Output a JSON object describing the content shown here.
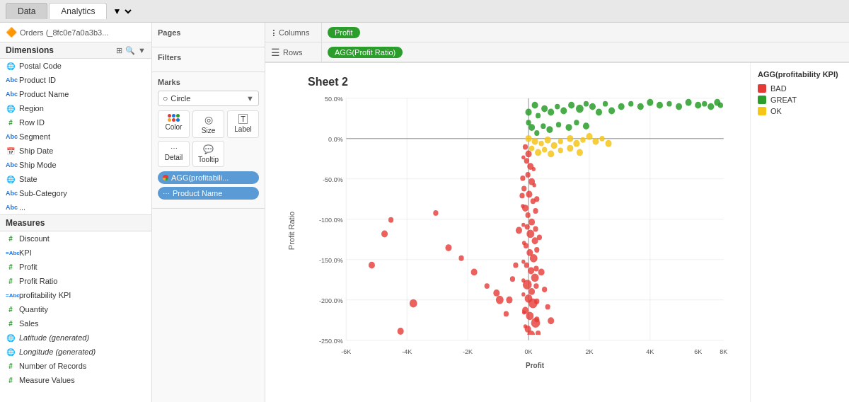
{
  "tabs": {
    "data_label": "Data",
    "analytics_label": "Analytics"
  },
  "datasource": {
    "icon": "🔶",
    "name": "Orders (_8fc0e7a0a3b3..."
  },
  "dimensions": {
    "header": "Dimensions",
    "items": [
      {
        "icon": "🌐",
        "type": "globe",
        "name": "Postal Code"
      },
      {
        "icon": "Abc",
        "type": "blue",
        "name": "Product ID"
      },
      {
        "icon": "Abc",
        "type": "blue",
        "name": "Product Name"
      },
      {
        "icon": "🌐",
        "type": "globe",
        "name": "Region"
      },
      {
        "icon": "#",
        "type": "green",
        "name": "Row ID"
      },
      {
        "icon": "Abc",
        "type": "blue",
        "name": "Segment"
      },
      {
        "icon": "📅",
        "type": "blue",
        "name": "Ship Date"
      },
      {
        "icon": "Abc",
        "type": "blue",
        "name": "Ship Mode"
      },
      {
        "icon": "🌐",
        "type": "globe",
        "name": "State"
      },
      {
        "icon": "Abc",
        "type": "blue",
        "name": "Sub-Category"
      },
      {
        "icon": "Abc",
        "type": "blue",
        "name": "..."
      }
    ]
  },
  "measures": {
    "header": "Measures",
    "items": [
      {
        "icon": "#",
        "type": "green",
        "name": "Discount"
      },
      {
        "icon": "=Abc",
        "type": "blue",
        "name": "KPI"
      },
      {
        "icon": "#",
        "type": "green",
        "name": "Profit"
      },
      {
        "icon": "#",
        "type": "green",
        "name": "Profit Ratio"
      },
      {
        "icon": "=Abc",
        "type": "blue",
        "name": "profitability KPI"
      },
      {
        "icon": "#",
        "type": "green",
        "name": "Quantity"
      },
      {
        "icon": "#",
        "type": "green",
        "name": "Sales"
      },
      {
        "icon": "🌐",
        "type": "globe",
        "name": "Latitude (generated)"
      },
      {
        "icon": "🌐",
        "type": "globe",
        "name": "Longitude (generated)"
      },
      {
        "icon": "#",
        "type": "green",
        "name": "Number of Records"
      },
      {
        "icon": "#",
        "type": "green",
        "name": "Measure Values"
      }
    ]
  },
  "pages": {
    "label": "Pages"
  },
  "filters": {
    "label": "Filters"
  },
  "marks": {
    "label": "Marks",
    "type": "Circle",
    "color_label": "Color",
    "size_label": "Size",
    "label_label": "Label",
    "detail_label": "Detail",
    "tooltip_label": "Tooltip",
    "pill1": "AGG(profitabili...",
    "pill2": "Product Name"
  },
  "shelves": {
    "columns_label": "Columns",
    "rows_label": "Rows",
    "columns_pill": "Profit",
    "rows_pill": "AGG(Profit Ratio)"
  },
  "chart": {
    "title": "Sheet 2",
    "x_label": "Profit",
    "y_label": "Profit Ratio",
    "x_ticks": [
      "-6K",
      "-4K",
      "-2K",
      "0K",
      "2K",
      "4K",
      "6K",
      "8K"
    ],
    "y_ticks": [
      "50.0%",
      "0.0%",
      "-50.0%",
      "-100.0%",
      "-150.0%",
      "-200.0%",
      "-250.0%"
    ]
  },
  "legend": {
    "title": "AGG(profitability KPI)",
    "items": [
      {
        "color": "#e53935",
        "label": "BAD"
      },
      {
        "color": "#2a9d2a",
        "label": "GREAT"
      },
      {
        "color": "#f5c518",
        "label": "OK"
      }
    ]
  }
}
